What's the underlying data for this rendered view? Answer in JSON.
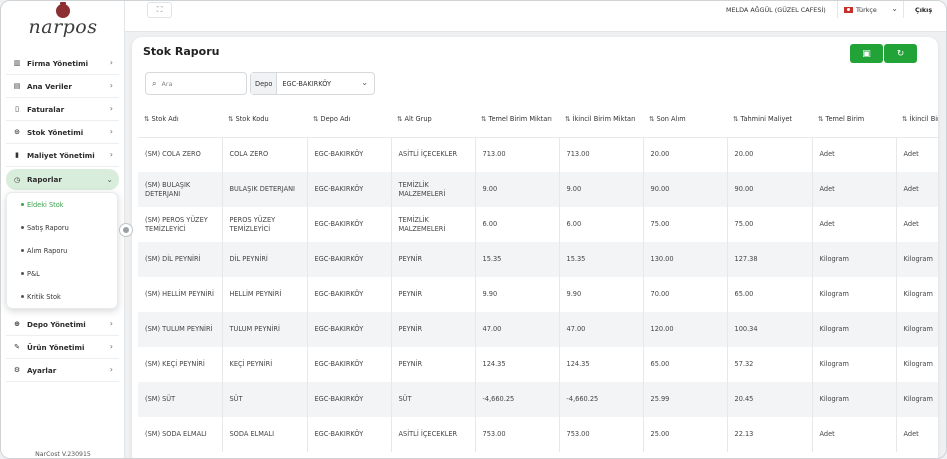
{
  "app": {
    "logo_text": "narpos",
    "version": "NarCost V.230915"
  },
  "sidebar": {
    "items": [
      {
        "label": "Firma Yönetimi",
        "icon": "building-icon"
      },
      {
        "label": "Ana Veriler",
        "icon": "database-icon"
      },
      {
        "label": "Faturalar",
        "icon": "receipt-icon"
      },
      {
        "label": "Stok Yönetimi",
        "icon": "box-icon"
      },
      {
        "label": "Maliyet Yönetimi",
        "icon": "chart-bar-icon"
      },
      {
        "label": "Raporlar",
        "icon": "clock-icon"
      },
      {
        "label": "Depo Yönetimi",
        "icon": "warehouse-icon"
      },
      {
        "label": "Ürün Yönetimi",
        "icon": "pencil-icon"
      },
      {
        "label": "Ayarlar",
        "icon": "gear-icon"
      }
    ],
    "submenu": [
      {
        "label": "Eldeki Stok"
      },
      {
        "label": "Satış Raporu"
      },
      {
        "label": "Alım Raporu"
      },
      {
        "label": "P&L"
      },
      {
        "label": "Kritik Stok"
      }
    ]
  },
  "topbar": {
    "user": "MELDA AĞGÜL (GÜZEL CAFESİ)",
    "language": "Türkçe",
    "logout": "Çıkış"
  },
  "page": {
    "title": "Stok Raporu",
    "search_placeholder": "Ara",
    "depo_label": "Depo",
    "depo_value": "EGC-BAKIRKÖY"
  },
  "table": {
    "headers": [
      "Stok Adı",
      "Stok Kodu",
      "Depo Adı",
      "Alt Grup",
      "Temel Birim Miktarı",
      "İkincil Birim Miktarı",
      "Son Alım",
      "Tahmini Maliyet",
      "Temel Birim",
      "İkincil Birim"
    ],
    "rows": [
      [
        "(SM) COLA ZERO",
        "COLA ZERO",
        "EGC-BAKIRKÖY",
        "ASİTLİ İÇECEKLER",
        "713.00",
        "713.00",
        "20.00",
        "20.00",
        "Adet",
        "Adet"
      ],
      [
        "(SM) BULAŞIK DETERJANI",
        "BULAŞIK DETERJANI",
        "EGC-BAKIRKÖY",
        "TEMİZLİK MALZEMELERİ",
        "9.00",
        "9.00",
        "90.00",
        "90.00",
        "Adet",
        "Adet"
      ],
      [
        "(SM) PEROS YÜZEY TEMİZLEYİCİ",
        "PEROS YÜZEY TEMİZLEYİCİ",
        "EGC-BAKIRKÖY",
        "TEMİZLİK MALZEMELERİ",
        "6.00",
        "6.00",
        "75.00",
        "75.00",
        "Adet",
        "Adet"
      ],
      [
        "(SM) DİL PEYNİRİ",
        "DİL PEYNİRİ",
        "EGC-BAKIRKÖY",
        "PEYNİR",
        "15.35",
        "15.35",
        "130.00",
        "127.38",
        "Kilogram",
        "Kilogram"
      ],
      [
        "(SM) HELLİM PEYNİRİ",
        "HELLİM PEYNİRİ",
        "EGC-BAKIRKÖY",
        "PEYNİR",
        "9.90",
        "9.90",
        "70.00",
        "65.00",
        "Kilogram",
        "Kilogram"
      ],
      [
        "(SM) TULUM PEYNİRİ",
        "TULUM PEYNİRİ",
        "EGC-BAKIRKÖY",
        "PEYNİR",
        "47.00",
        "47.00",
        "120.00",
        "100.34",
        "Kilogram",
        "Kilogram"
      ],
      [
        "(SM) KEÇİ PEYNİRİ",
        "KEÇİ PEYNİRİ",
        "EGC-BAKIRKÖY",
        "PEYNİR",
        "124.35",
        "124.35",
        "65.00",
        "57.32",
        "Kilogram",
        "Kilogram"
      ],
      [
        "(SM) SÜT",
        "SÜT",
        "EGC-BAKIRKÖY",
        "SÜT",
        "-4,660.25",
        "-4,660.25",
        "25.99",
        "20.45",
        "Kilogram",
        "Kilogram"
      ],
      [
        "(SM) SODA ELMALI",
        "SODA ELMALI",
        "EGC-BAKIRKÖY",
        "ASİTLİ İÇECEKLER",
        "753.00",
        "753.00",
        "25.00",
        "22.13",
        "Adet",
        "Adet"
      ]
    ]
  },
  "colors": {
    "accent_green": "#21a338",
    "active_menu_bg": "#d9eddc",
    "active_sub_text": "#3aa24c",
    "brand_logo": "#8c2f32"
  }
}
